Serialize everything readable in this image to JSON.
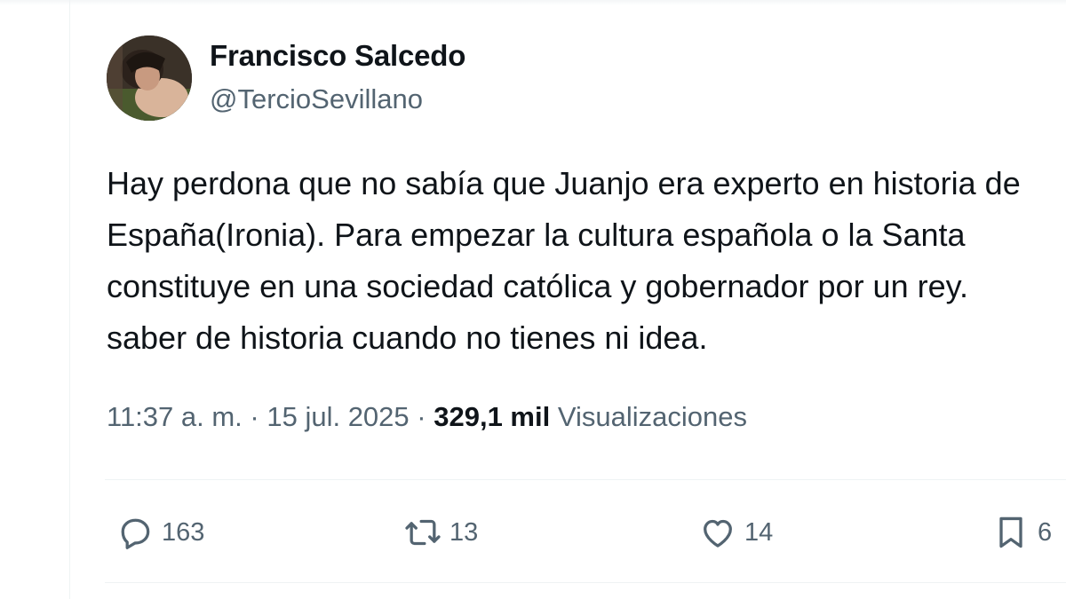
{
  "author": {
    "name": "Francisco Salcedo",
    "handle": "@TercioSevillano"
  },
  "tweet": {
    "lines": [
      "Hay perdona que no sabía que Juanjo era experto en historia de",
      "España(Ironia). Para empezar la cultura española o la Santa",
      "constituye en una sociedad católica y gobernador por un rey.",
      "saber de historia cuando no tienes ni idea."
    ]
  },
  "meta": {
    "time": "11:37 a. m.",
    "separator": " · ",
    "date": "15 jul. 2025",
    "views_count": "329,1 mil",
    "views_label": "Visualizaciones"
  },
  "actions": {
    "replies": "163",
    "retweets": "13",
    "likes": "14",
    "bookmarks": "6"
  },
  "icons": {
    "reply": "reply-icon",
    "retweet": "retweet-icon",
    "like": "heart-icon",
    "bookmark": "bookmark-icon"
  },
  "colors": {
    "text": "#0f1419",
    "secondary": "#536471",
    "divider": "#eff3f4"
  }
}
